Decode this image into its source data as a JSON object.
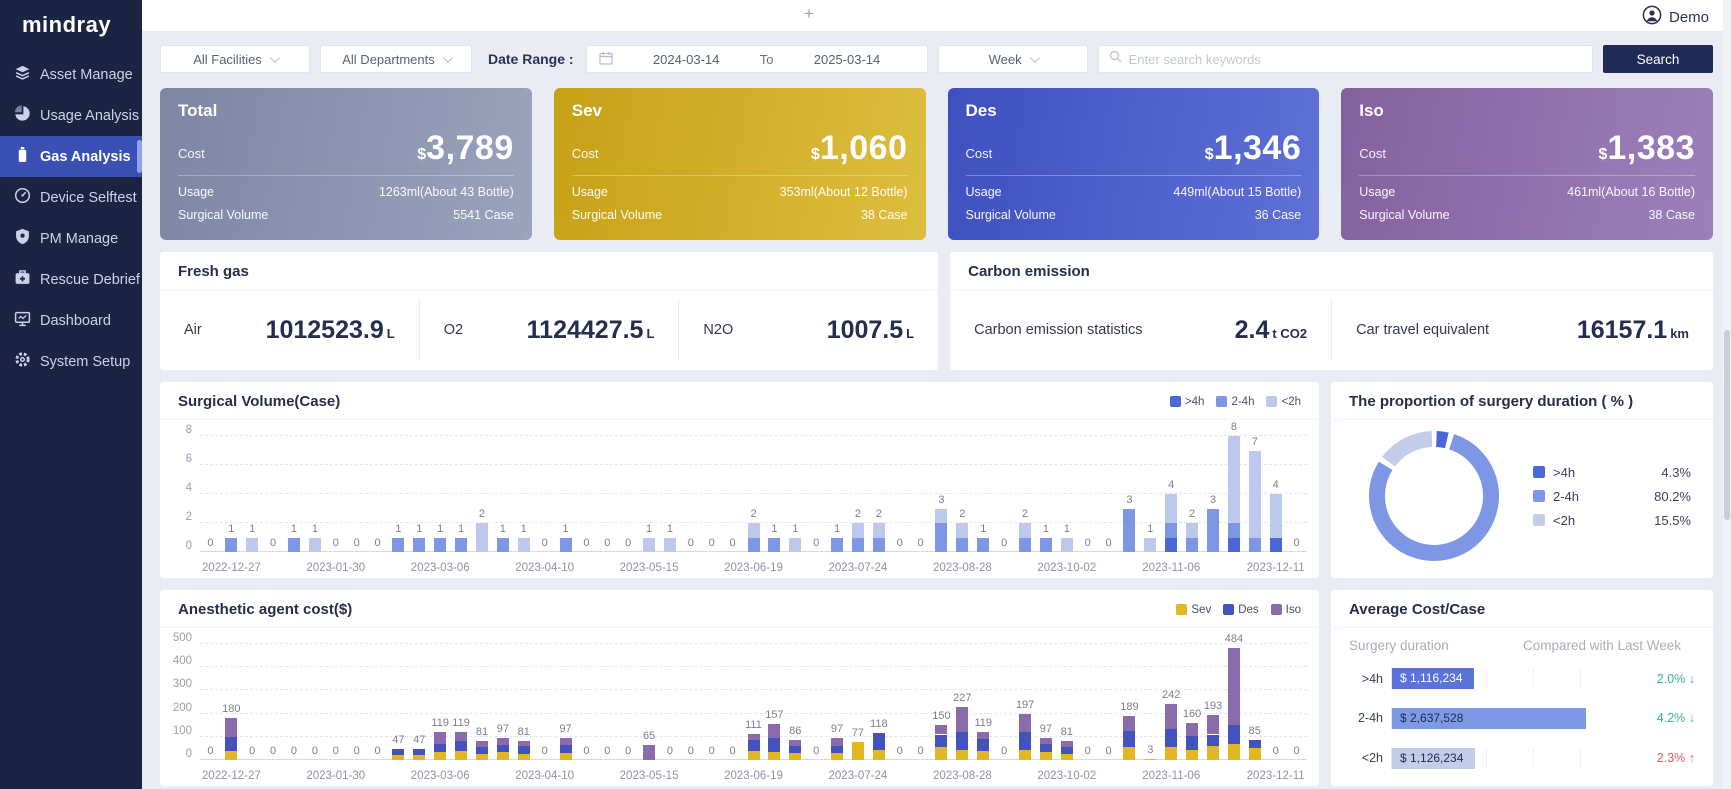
{
  "header": {
    "logo": "mindray",
    "user": "Demo",
    "plus": "+"
  },
  "sidebar": {
    "items": [
      {
        "label": "Asset Manage",
        "icon": "layers-icon",
        "active": false
      },
      {
        "label": "Usage Analysis",
        "icon": "pie-chart-icon",
        "active": false
      },
      {
        "label": "Gas Analysis",
        "icon": "gas-cylinder-icon",
        "active": true
      },
      {
        "label": "Device Selftest",
        "icon": "gauge-icon",
        "active": false
      },
      {
        "label": "PM Manage",
        "icon": "shield-icon",
        "active": false
      },
      {
        "label": "Rescue Debrief",
        "icon": "first-aid-icon",
        "active": false
      },
      {
        "label": "Dashboard",
        "icon": "monitor-icon",
        "active": false
      },
      {
        "label": "System Setup",
        "icon": "gear-icon",
        "active": false
      }
    ]
  },
  "filters": {
    "facility": "All Facilities",
    "department": "All Departments",
    "date_range_label": "Date Range :",
    "date_start": "2024-03-14",
    "date_to_label": "To",
    "date_end": "2025-03-14",
    "granularity": "Week",
    "search_placeholder": "Enter search keywords",
    "search_button": "Search"
  },
  "cards": [
    {
      "title": "Total",
      "cost_label": "Cost",
      "currency": "$",
      "cost": "3,789",
      "usage_label": "Usage",
      "usage": "1263ml(About 43 Bottle)",
      "volume_label": "Surgical Volume",
      "volume": "5541 Case",
      "color_from": "#7e86a4",
      "color_to": "#9ba2bc"
    },
    {
      "title": "Sev",
      "cost_label": "Cost",
      "currency": "$",
      "cost": "1,060",
      "usage_label": "Usage",
      "usage": "353ml(About 12 Bottle)",
      "volume_label": "Surgical Volume",
      "volume": "38 Case",
      "color_from": "#c7a117",
      "color_to": "#debe3e"
    },
    {
      "title": "Des",
      "cost_label": "Cost",
      "currency": "$",
      "cost": "1,346",
      "usage_label": "Usage",
      "usage": "449ml(About 15 Bottle)",
      "volume_label": "Surgical Volume",
      "volume": "36 Case",
      "color_from": "#3f50c0",
      "color_to": "#5e71d6"
    },
    {
      "title": "Iso",
      "cost_label": "Cost",
      "currency": "$",
      "cost": "1,383",
      "usage_label": "Usage",
      "usage": "461ml(About 16 Bottle)",
      "volume_label": "Surgical Volume",
      "volume": "38 Case",
      "color_from": "#83619e",
      "color_to": "#9d80bb"
    }
  ],
  "fresh_gas": {
    "title": "Fresh gas",
    "items": [
      {
        "name": "Air",
        "value": "1012523.9",
        "unit": "L"
      },
      {
        "name": "O2",
        "value": "1124427.5",
        "unit": "L"
      },
      {
        "name": "N2O",
        "value": "1007.5",
        "unit": "L"
      }
    ]
  },
  "carbon": {
    "title": "Carbon emission",
    "items": [
      {
        "label": "Carbon emission statistics",
        "value": "2.4",
        "unit": "t CO2"
      },
      {
        "label": "Car travel equivalent",
        "value": "16157.1",
        "unit": "km"
      }
    ]
  },
  "chart_data": [
    {
      "id": "surgical_volume",
      "type": "bar",
      "stacked": true,
      "title": "Surgical Volume(Case)",
      "ymax": 8,
      "yticks": [
        0,
        2,
        4,
        6,
        8
      ],
      "grid": "dashed",
      "legend_position": "top-right",
      "x_tick_labels": [
        "2022-12-27",
        "2023-01-30",
        "2023-03-06",
        "2023-04-10",
        "2023-05-15",
        "2023-06-19",
        "2023-07-24",
        "2023-08-28",
        "2023-10-02",
        "2023-11-06",
        "2023-12-11"
      ],
      "tick_start": 1,
      "tick_every": 5,
      "series": [
        {
          "name": ">4h",
          "color": "#4b68d8",
          "values": [
            0,
            0,
            0,
            0,
            0,
            0,
            0,
            0,
            0,
            0,
            0,
            0,
            0,
            0,
            0,
            0,
            0,
            0,
            0,
            0,
            0,
            0,
            0,
            0,
            0,
            0,
            0,
            0,
            0,
            0,
            0,
            0,
            0,
            0,
            0,
            0,
            0,
            0,
            0,
            0,
            0,
            0,
            0,
            0,
            0,
            0,
            1,
            0,
            0,
            1,
            0,
            1,
            0
          ]
        },
        {
          "name": "2-4h",
          "color": "#7d97e4",
          "values": [
            0,
            1,
            0,
            0,
            1,
            0,
            0,
            0,
            0,
            1,
            1,
            1,
            1,
            0,
            1,
            0,
            0,
            1,
            0,
            0,
            0,
            0,
            0,
            0,
            0,
            0,
            1,
            1,
            0,
            0,
            1,
            1,
            1,
            0,
            0,
            2,
            1,
            1,
            0,
            1,
            1,
            0,
            0,
            0,
            3,
            0,
            1,
            1,
            3,
            1,
            1,
            0,
            0
          ]
        },
        {
          "name": "<2h",
          "color": "#bdc9ec",
          "values": [
            0,
            0,
            1,
            0,
            0,
            1,
            0,
            0,
            0,
            0,
            0,
            0,
            0,
            2,
            0,
            1,
            0,
            0,
            0,
            0,
            0,
            1,
            1,
            0,
            0,
            0,
            1,
            0,
            1,
            0,
            0,
            1,
            1,
            0,
            0,
            1,
            1,
            0,
            0,
            1,
            0,
            1,
            0,
            0,
            0,
            1,
            2,
            1,
            0,
            6,
            6,
            3,
            0
          ]
        }
      ],
      "totals": [
        0,
        1,
        1,
        0,
        1,
        1,
        0,
        0,
        0,
        1,
        1,
        1,
        1,
        2,
        1,
        1,
        0,
        1,
        0,
        0,
        0,
        1,
        1,
        0,
        0,
        0,
        2,
        1,
        1,
        0,
        1,
        2,
        2,
        0,
        0,
        3,
        2,
        1,
        0,
        2,
        1,
        1,
        0,
        0,
        3,
        1,
        4,
        2,
        3,
        8,
        7,
        4,
        0
      ]
    },
    {
      "id": "surgery_duration_proportion",
      "type": "pie",
      "title": "The proportion of surgery duration ( % )",
      "legend_position": "right",
      "slices": [
        {
          "label": ">4h",
          "value": 4.3,
          "value_label": "4.3%",
          "color": "#4b68d8"
        },
        {
          "label": "2-4h",
          "value": 80.2,
          "value_label": "80.2%",
          "color": "#7d97e4"
        },
        {
          "label": "<2h",
          "value": 15.5,
          "value_label": "15.5%",
          "color": "#c3cdea"
        }
      ]
    },
    {
      "id": "anesthetic_cost",
      "type": "bar",
      "stacked": true,
      "title": "Anesthetic agent cost($)",
      "ymax": 500,
      "yticks": [
        0,
        100,
        200,
        300,
        400,
        500
      ],
      "grid": "dashed",
      "legend_position": "top-right",
      "x_tick_labels": [
        "2022-12-27",
        "2023-01-30",
        "2023-03-06",
        "2023-04-10",
        "2023-05-15",
        "2023-06-19",
        "2023-07-24",
        "2023-08-28",
        "2023-10-02",
        "2023-11-06",
        "2023-12-11"
      ],
      "tick_start": 1,
      "tick_every": 5,
      "series": [
        {
          "name": "Sev",
          "color": "#e3b722",
          "values": [
            0,
            40,
            0,
            0,
            0,
            0,
            0,
            0,
            0,
            20,
            20,
            35,
            40,
            25,
            35,
            25,
            0,
            30,
            0,
            0,
            0,
            0,
            0,
            0,
            0,
            0,
            40,
            35,
            30,
            0,
            30,
            77,
            45,
            0,
            0,
            55,
            45,
            40,
            0,
            45,
            35,
            25,
            0,
            0,
            55,
            3,
            55,
            45,
            60,
            70,
            50,
            0,
            0
          ]
        },
        {
          "name": "Des",
          "color": "#4353be",
          "values": [
            0,
            60,
            0,
            0,
            0,
            0,
            0,
            0,
            0,
            27,
            27,
            35,
            40,
            30,
            30,
            35,
            0,
            35,
            0,
            0,
            0,
            0,
            0,
            0,
            0,
            0,
            45,
            60,
            30,
            0,
            30,
            0,
            73,
            0,
            0,
            55,
            75,
            50,
            0,
            75,
            35,
            30,
            0,
            0,
            70,
            0,
            80,
            60,
            50,
            80,
            35,
            0,
            0
          ]
        },
        {
          "name": "Iso",
          "color": "#8a6cab",
          "values": [
            0,
            80,
            0,
            0,
            0,
            0,
            0,
            0,
            0,
            0,
            0,
            49,
            39,
            26,
            32,
            21,
            0,
            32,
            0,
            0,
            0,
            65,
            0,
            0,
            0,
            0,
            26,
            62,
            26,
            0,
            37,
            0,
            0,
            0,
            0,
            40,
            107,
            29,
            0,
            77,
            27,
            26,
            0,
            0,
            64,
            0,
            107,
            55,
            83,
            334,
            0,
            0,
            0
          ]
        }
      ],
      "totals": [
        0,
        180,
        0,
        0,
        0,
        0,
        0,
        0,
        0,
        47,
        47,
        119,
        119,
        81,
        97,
        81,
        0,
        97,
        0,
        0,
        0,
        65,
        0,
        0,
        0,
        0,
        111,
        157,
        86,
        0,
        97,
        77,
        118,
        0,
        0,
        150,
        227,
        119,
        0,
        197,
        97,
        81,
        0,
        0,
        189,
        3,
        242,
        160,
        193,
        484,
        85,
        0,
        0
      ]
    },
    {
      "id": "average_cost_case",
      "type": "table",
      "title": "Average Cost/Case",
      "col1": "Surgery duration",
      "col2": "Compared with Last Week",
      "rows": [
        {
          "label": ">4h",
          "value": 1116234,
          "value_label": "$ 1,116,234",
          "bar_color": "#5a73d8",
          "text_color": "#ffffff",
          "change": "2.0%",
          "dir": "down"
        },
        {
          "label": "2-4h",
          "value": 2637528,
          "value_label": "$ 2,637,528",
          "bar_color": "#7d99e6",
          "text_color": "#222c52",
          "change": "4.2%",
          "dir": "down"
        },
        {
          "label": "<2h",
          "value": 1126234,
          "value_label": "$ 1,126,234",
          "bar_color": "#c3cdea",
          "text_color": "#222c52",
          "change": "2.3%",
          "dir": "up"
        }
      ]
    }
  ]
}
